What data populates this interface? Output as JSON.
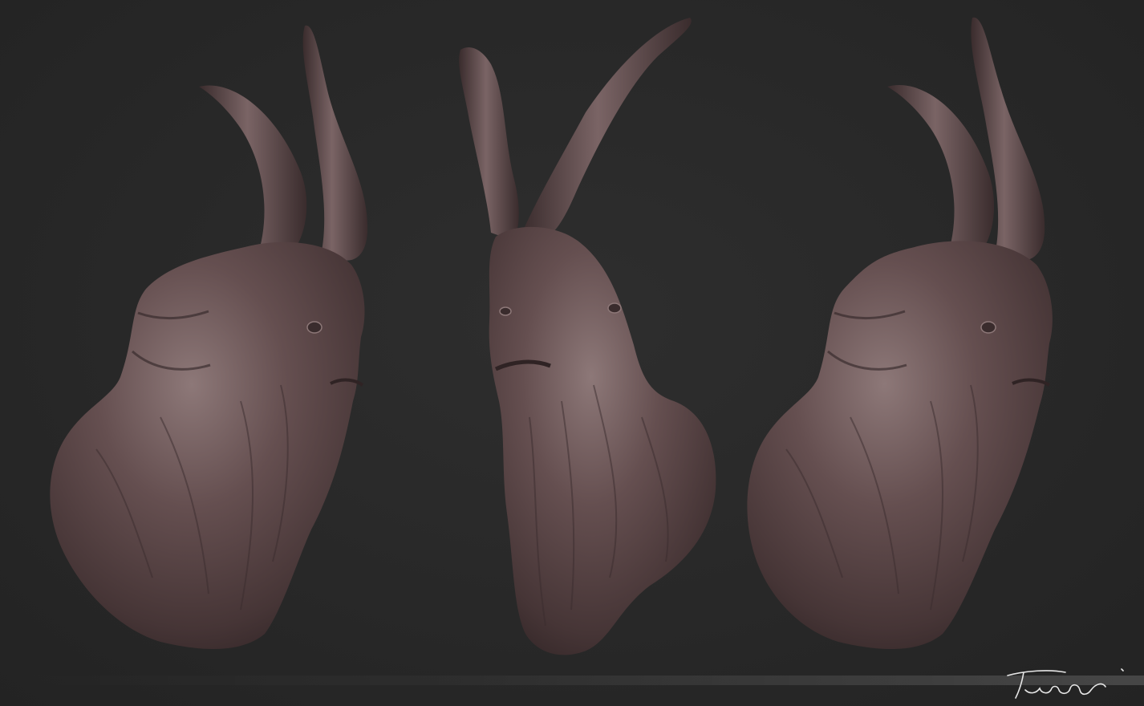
{
  "scene": {
    "background_color": "#282828",
    "model_color": "#5a4546",
    "highlight_color": "#8d7878",
    "shadow_color": "#2f2324"
  },
  "views": [
    {
      "view": "left-side"
    },
    {
      "view": "front"
    },
    {
      "view": "right-side"
    }
  ],
  "signature": {
    "text": "Tudor"
  }
}
